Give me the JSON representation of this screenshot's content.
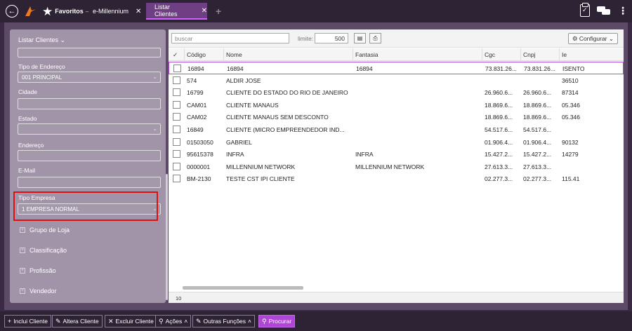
{
  "topbar": {
    "favorites_label": "Favoritos",
    "tabs": [
      {
        "label": "e-Millennium",
        "active": false
      },
      {
        "label": "Listar Clientes",
        "active": true
      }
    ]
  },
  "sidebar": {
    "title": "Listar Clientes",
    "fields": {
      "tipo_endereco_label": "Tipo de Endereço",
      "tipo_endereco_value": "001 PRINCIPAL",
      "cidade_label": "Cidade",
      "estado_label": "Estado",
      "endereco_label": "Endereço",
      "email_label": "E-Mail",
      "tipo_empresa_label": "Tipo Empresa",
      "tipo_empresa_value": "1 EMPRESA NORMAL"
    },
    "groups": [
      "Grupo de Loja",
      "Classificação",
      "Profissão",
      "Vendedor"
    ]
  },
  "toolbar": {
    "search_placeholder": "buscar",
    "limit_label": "limite:",
    "limit_value": "500",
    "configure_label": "Configurar"
  },
  "grid": {
    "columns": [
      "Código",
      "Nome",
      "Fantasia",
      "Cgc",
      "Cnpj",
      "Ie"
    ],
    "rows": [
      {
        "codigo": "16894",
        "nome": "16894",
        "fantasia": "16894",
        "cgc": "73.831.26...",
        "cnpj": "73.831.26...",
        "ie": "ISENTO"
      },
      {
        "codigo": "574",
        "nome": "ALDIR JOSE",
        "fantasia": "",
        "cgc": "",
        "cnpj": "",
        "ie": "36510"
      },
      {
        "codigo": "16799",
        "nome": "CLIENTE DO ESTADO DO RIO DE JANEIRO",
        "fantasia": "",
        "cgc": "26.960.6...",
        "cnpj": "26.960.6...",
        "ie": "87314"
      },
      {
        "codigo": "CAM01",
        "nome": "CLIENTE MANAUS",
        "fantasia": "",
        "cgc": "18.869.6...",
        "cnpj": "18.869.6...",
        "ie": "05.346"
      },
      {
        "codigo": "CAM02",
        "nome": "CLIENTE MANAUS SEM DESCONTO",
        "fantasia": "",
        "cgc": "18.869.6...",
        "cnpj": "18.869.6...",
        "ie": "05.346"
      },
      {
        "codigo": "16849",
        "nome": "CLIENTE (MICRO EMPREENDEDOR IND...",
        "fantasia": "",
        "cgc": "54.517.6...",
        "cnpj": "54.517.6...",
        "ie": ""
      },
      {
        "codigo": "01503050",
        "nome": "GABRIEL",
        "fantasia": "",
        "cgc": "01.906.4...",
        "cnpj": "01.906.4...",
        "ie": "90132"
      },
      {
        "codigo": "95615378",
        "nome": "INFRA",
        "fantasia": "INFRA",
        "cgc": "15.427.2...",
        "cnpj": "15.427.2...",
        "ie": "14279"
      },
      {
        "codigo": "0000001",
        "nome": "MILLENNIUM NETWORK",
        "fantasia": "MILLENNIUM NETWORK",
        "cgc": "27.613.3...",
        "cnpj": "27.613.3...",
        "ie": ""
      },
      {
        "codigo": "BM-2130",
        "nome": "TESTE CST IPI CLIENTE",
        "fantasia": "",
        "cgc": "02.277.3...",
        "cnpj": "02.277.3...",
        "ie": "115.41"
      }
    ],
    "count": "10"
  },
  "actions": [
    {
      "label": "Inclui Cliente",
      "icon": "plus-icon"
    },
    {
      "label": "Altera Cliente",
      "icon": "edit-icon"
    },
    {
      "label": "Excluir Cliente",
      "icon": "x-icon"
    },
    {
      "label": "Ações",
      "icon": "pin-icon"
    },
    {
      "label": "Outras Funções",
      "icon": "edit-icon"
    },
    {
      "label": "Procurar",
      "icon": "search-icon"
    }
  ]
}
